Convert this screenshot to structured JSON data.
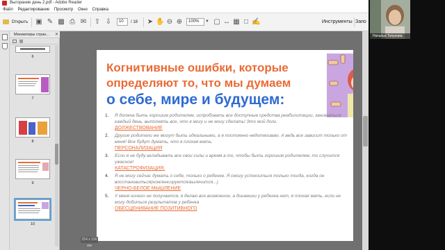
{
  "window": {
    "title": "Выгорание день 2.pdf - Adobe Reader"
  },
  "menu": [
    "Файл",
    "Редактирование",
    "Просмотр",
    "Окно",
    "Справка"
  ],
  "toolbar": {
    "open_label": "Открыть",
    "page_current": "10",
    "page_total": "/ 18",
    "zoom": "100%",
    "tools_label": "Инструменты",
    "comments_label": "Запо"
  },
  "thumbnails": {
    "title": "Миниатюры стран...",
    "pages": [
      "6",
      "7",
      "8",
      "9",
      "10"
    ],
    "selected": "10"
  },
  "slide": {
    "title_line1": "Когнитивные ошибки, которые",
    "title_line2": "определяют то, что мы думаем",
    "title_line3": "о себе, мире и будущем:",
    "points": [
      {
        "num": "1.",
        "text": "Я должна быть хорошим родителем, испробовать все доступные средства реабилитации, заниматься каждый день, выполнять все, что я могу и не могу сделать! Это мой долг.",
        "tag": "ДОЛЖЕСТВОВАНИЕ"
      },
      {
        "num": "2.",
        "text": "Другие родители же могут быть идеальными, а я постоянно недотягиваю. А ведь все зависит только от меня! Все будут думать, что я плохая мать.",
        "tag": "ПЕРСОНАЛИЗАЦИЯ"
      },
      {
        "num": "3.",
        "text": "Если я не буду вкладывать все свои силы и время в то, чтобы быть хорошим родителем, то случится ужасное!",
        "tag": "КАТАСТРОФИЗАЦИЯ."
      },
      {
        "num": "4.",
        "text": "Я не могу сейчас думать о себе, только о ребенке. Я смогу успокоиться только тогда, когда он восстановиться(компенсируется/вылечится...)",
        "tag": "ЧЕРНО-БЕЛОЕ МЫШЛЕНИЕ"
      },
      {
        "num": "5.",
        "text": "У меня ничего не получается, я делаю все возможное, а динамики у ребенка нет, я плохая мать, если не могу добиться результатов у ребенка",
        "tag": "ОБЕСЦЕНИВАНИЕ ПОЗИТИВНОГО"
      }
    ]
  },
  "page_size_badge": "254 x 190 мм",
  "participant": {
    "name": "Наталья Топунова"
  },
  "colors": {
    "accent_orange": "#ea6a34",
    "accent_blue": "#2f6bd0",
    "selection": "#5aa2dd"
  }
}
